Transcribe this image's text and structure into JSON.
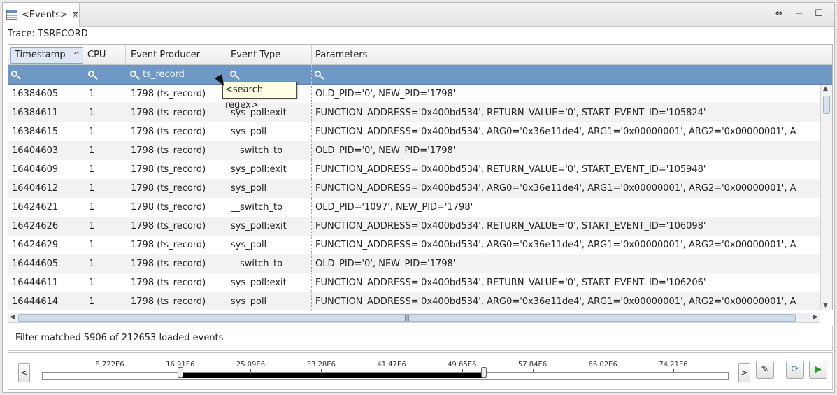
{
  "tab": {
    "title": "<Events>",
    "close_glyph": "⊠"
  },
  "window_controls": {
    "restore": "⇔",
    "minimize": "−",
    "maximize": "☐"
  },
  "trace_label": "Trace: TSRECORD",
  "columns": [
    "Timestamp",
    "CPU",
    "Event Producer",
    "Event Type",
    "Parameters"
  ],
  "sort_glyph": "^",
  "filters": [
    "",
    "",
    "ts_record",
    "",
    ""
  ],
  "tooltip": "<search regex>",
  "rows": [
    [
      "16384605",
      "1",
      "1798 (ts_record)",
      "",
      "OLD_PID='0', NEW_PID='1798'"
    ],
    [
      "16384611",
      "1",
      "1798 (ts_record)",
      "sys_poll:exit",
      "FUNCTION_ADDRESS='0x400bd534', RETURN_VALUE='0', START_EVENT_ID='105824'"
    ],
    [
      "16384615",
      "1",
      "1798 (ts_record)",
      "sys_poll",
      "FUNCTION_ADDRESS='0x400bd534', ARG0='0x36e11de4', ARG1='0x00000001', ARG2='0x00000001', A"
    ],
    [
      "16404603",
      "1",
      "1798 (ts_record)",
      "__switch_to",
      "OLD_PID='0', NEW_PID='1798'"
    ],
    [
      "16404609",
      "1",
      "1798 (ts_record)",
      "sys_poll:exit",
      "FUNCTION_ADDRESS='0x400bd534', RETURN_VALUE='0', START_EVENT_ID='105948'"
    ],
    [
      "16404612",
      "1",
      "1798 (ts_record)",
      "sys_poll",
      "FUNCTION_ADDRESS='0x400bd534', ARG0='0x36e11de4', ARG1='0x00000001', ARG2='0x00000001', A"
    ],
    [
      "16424621",
      "1",
      "1798 (ts_record)",
      "__switch_to",
      "OLD_PID='1097', NEW_PID='1798'"
    ],
    [
      "16424626",
      "1",
      "1798 (ts_record)",
      "sys_poll:exit",
      "FUNCTION_ADDRESS='0x400bd534', RETURN_VALUE='0', START_EVENT_ID='106098'"
    ],
    [
      "16424629",
      "1",
      "1798 (ts_record)",
      "sys_poll",
      "FUNCTION_ADDRESS='0x400bd534', ARG0='0x36e11de4', ARG1='0x00000001', ARG2='0x00000001', A"
    ],
    [
      "16444605",
      "1",
      "1798 (ts_record)",
      "__switch_to",
      "OLD_PID='0', NEW_PID='1798'"
    ],
    [
      "16444611",
      "1",
      "1798 (ts_record)",
      "sys_poll:exit",
      "FUNCTION_ADDRESS='0x400bd534', RETURN_VALUE='0', START_EVENT_ID='106206'"
    ],
    [
      "16444614",
      "1",
      "1798 (ts_record)",
      "sys_poll",
      "FUNCTION_ADDRESS='0x400bd534', ARG0='0x36e11de4', ARG1='0x00000001', ARG2='0x00000001', A"
    ]
  ],
  "scroll": {
    "up": "▲",
    "down": "▼",
    "left": "◀",
    "right": "▶",
    "grip": "|||"
  },
  "status": "Filter matched 5906 of 212653 loaded events",
  "timeline": {
    "prev": "<",
    "next": ">",
    "ticks": [
      "8.722E6",
      "16.91E6",
      "25.09E6",
      "33.28E6",
      "41.47E6",
      "49.65E6",
      "57.84E6",
      "66.02E6",
      "74.21E6"
    ],
    "range_start": "16.91E6",
    "range_end": "52.2E6",
    "edit_glyph": "✎",
    "sync_glyph": "⟳",
    "play_glyph": "▶"
  },
  "colors": {
    "filter_bar": "#6f98c6",
    "selection": "#dfe7f2"
  }
}
